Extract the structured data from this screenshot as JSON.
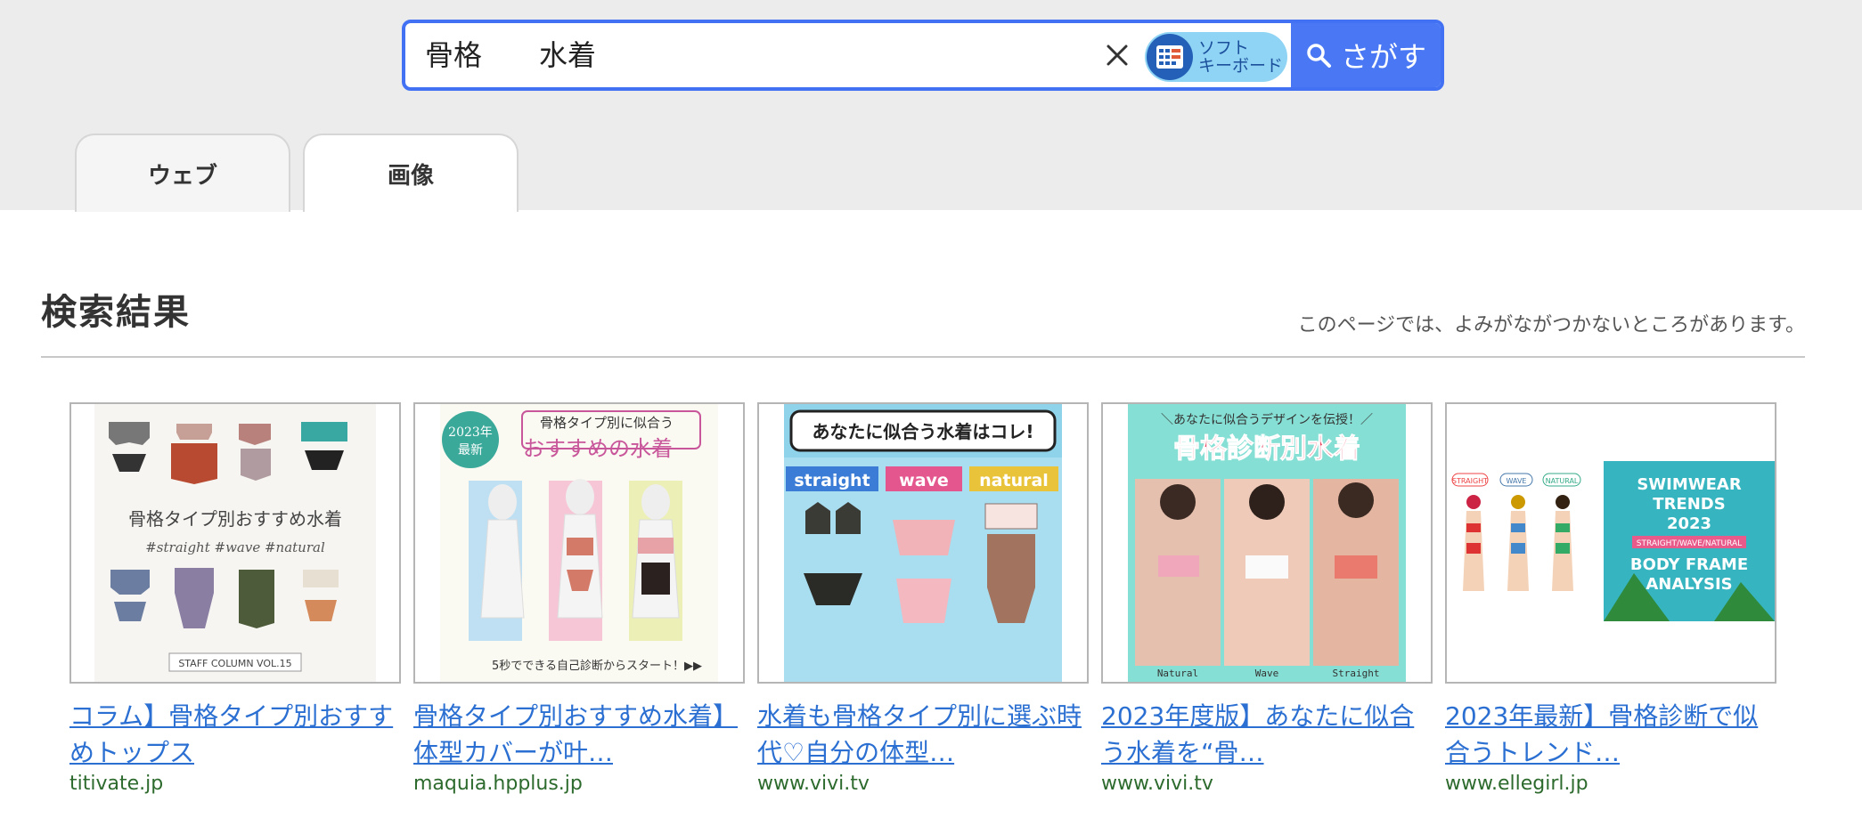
{
  "search": {
    "query": "骨格　　水着",
    "keyboard_label": "ソフト\nキーボード",
    "button_label": "さがす"
  },
  "tabs": [
    {
      "label": "ウェブ",
      "active": false
    },
    {
      "label": "画像",
      "active": true
    }
  ],
  "results": {
    "title": "検索結果",
    "notice": "このページでは、よみがながつかないところがあります。"
  },
  "cards": [
    {
      "title": "コラム】骨格タイプ別おすすめトップス",
      "domain": "titivate.jp",
      "thumb_text": {
        "main": "骨格タイプ別おすすめ水着",
        "tags": "#straight #wave #natural",
        "footer": "STAFF COLUMN VOL.15"
      }
    },
    {
      "title": "骨格タイプ別おすすめ水着】体型カバーが叶…",
      "domain": "maquia.hpplus.jp",
      "thumb_text": {
        "badge_year": "2023年",
        "badge_new": "最新",
        "line1": "骨格タイプ別に似合う",
        "line2": "おすすめの水着",
        "footer": "5秒でできる自己診断からスタート！▶▶"
      }
    },
    {
      "title": "水着も骨格タイプ別に選ぶ時代♡自分の体型…",
      "domain": "www.vivi.tv",
      "thumb_text": {
        "bubble": "あなたに似合う水着はコレ!",
        "tag1": "straight",
        "tag2": "wave",
        "tag3": "natural"
      }
    },
    {
      "title": "2023年度版】あなたに似合う水着を“骨…",
      "domain": "www.vivi.tv",
      "thumb_text": {
        "top": "＼あなたに似合うデザインを伝授！／",
        "main": "骨格診断別水着",
        "l1": "Natural",
        "l2": "Wave",
        "l3": "Straight"
      }
    },
    {
      "title": "2023年最新】骨格診断で似合うトレンド…",
      "domain": "www.ellegirl.jp",
      "thumb_text": {
        "t1": "STRAIGHT",
        "t2": "WAVE",
        "t3": "NATURAL",
        "h1": "SWIMWEAR",
        "h2": "TRENDS",
        "h3": "2023",
        "sub": "STRAIGHT/WAVE/NATURAL",
        "h4": "BODY FRAME",
        "h5": "ANALYSIS"
      }
    }
  ],
  "colors": {
    "accent": "#4a78f5",
    "link": "#2a6fd1",
    "domain": "#2d6a2d",
    "header_bg": "#ececec"
  }
}
